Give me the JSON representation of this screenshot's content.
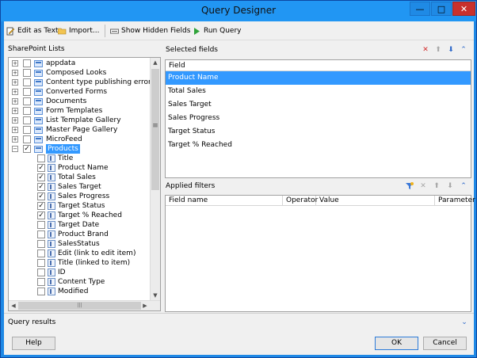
{
  "window": {
    "title": "Query Designer",
    "minimize": "—",
    "maximize": "□",
    "close": "✕"
  },
  "toolbar": {
    "edit_as_text": "Edit as Text",
    "import": "Import...",
    "show_hidden_fields": "Show Hidden Fields",
    "run_query": "Run Query"
  },
  "lists_panel": {
    "label": "SharePoint Lists",
    "items": [
      {
        "label": "appdata",
        "checked": false,
        "expanded": false
      },
      {
        "label": "Composed Looks",
        "checked": false,
        "expanded": false
      },
      {
        "label": "Content type publishing error log",
        "checked": false,
        "expanded": false
      },
      {
        "label": "Converted Forms",
        "checked": false,
        "expanded": false
      },
      {
        "label": "Documents",
        "checked": false,
        "expanded": false
      },
      {
        "label": "Form Templates",
        "checked": false,
        "expanded": false
      },
      {
        "label": "List Template Gallery",
        "checked": false,
        "expanded": false
      },
      {
        "label": "Master Page Gallery",
        "checked": false,
        "expanded": false
      },
      {
        "label": "MicroFeed",
        "checked": false,
        "expanded": false
      },
      {
        "label": "Products",
        "checked": true,
        "expanded": true,
        "selected": true
      }
    ],
    "fields": [
      {
        "label": "Title",
        "checked": false
      },
      {
        "label": "Product Name",
        "checked": true
      },
      {
        "label": "Total Sales",
        "checked": true
      },
      {
        "label": "Sales Target",
        "checked": true
      },
      {
        "label": "Sales Progress",
        "checked": true
      },
      {
        "label": "Target Status",
        "checked": true
      },
      {
        "label": "Target % Reached",
        "checked": true
      },
      {
        "label": "Target Date",
        "checked": false
      },
      {
        "label": "Product Brand",
        "checked": false
      },
      {
        "label": "SalesStatus",
        "checked": false
      },
      {
        "label": "Edit (link to edit item)",
        "checked": false
      },
      {
        "label": "Title (linked to item)",
        "checked": false
      },
      {
        "label": "ID",
        "checked": false
      },
      {
        "label": "Content Type",
        "checked": false
      },
      {
        "label": "Modified",
        "checked": false
      }
    ]
  },
  "selected_fields": {
    "label": "Selected fields",
    "column_header": "Field",
    "rows": [
      "Product Name",
      "Total Sales",
      "Sales Target",
      "Sales Progress",
      "Target Status",
      "Target % Reached"
    ]
  },
  "applied_filters": {
    "label": "Applied filters",
    "columns": [
      "Field name",
      "Operator",
      "Value",
      "Parameter"
    ]
  },
  "query_results": {
    "label": "Query results"
  },
  "buttons": {
    "help": "Help",
    "ok": "OK",
    "cancel": "Cancel"
  },
  "colors": {
    "accent": "#3399ff",
    "title_bar": "#2196f3",
    "close": "#c9302c"
  }
}
